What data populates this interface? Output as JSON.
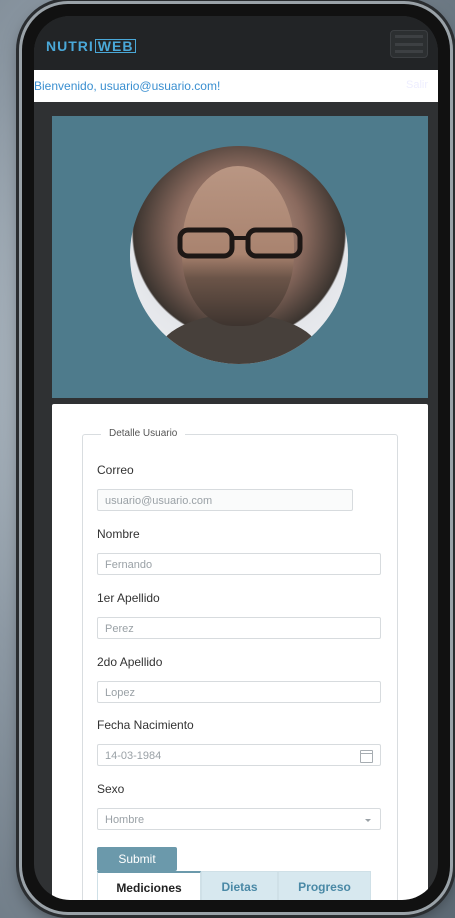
{
  "navbar": {
    "logo_part1": "NUTRI",
    "logo_part2": "WEB",
    "menu_icon": "hamburger-icon"
  },
  "welcome": {
    "text": "Bienvenido, usuario@usuario.com!",
    "right_link": "Salir"
  },
  "profile": {
    "avatar_icon": "user-photo"
  },
  "form": {
    "legend": "Detalle Usuario",
    "fields": {
      "correo": {
        "label": "Correo",
        "value": "usuario@usuario.com"
      },
      "nombre": {
        "label": "Nombre",
        "value": "Fernando"
      },
      "apellido1": {
        "label": "1er Apellido",
        "value": "Perez"
      },
      "apellido2": {
        "label": "2do Apellido",
        "value": "Lopez"
      },
      "fecha": {
        "label": "Fecha Nacimiento",
        "value": "14-03-1984",
        "icon": "calendar-icon"
      },
      "sexo": {
        "label": "Sexo",
        "value": "Hombre",
        "icon": "chevron-down-icon"
      }
    },
    "submit_label": "Submit"
  },
  "tabs": [
    {
      "label": "Mediciones",
      "active": true
    },
    {
      "label": "Dietas",
      "active": false
    },
    {
      "label": "Progreso",
      "active": false
    }
  ],
  "colors": {
    "header_bg": "#4e7b8c",
    "accent": "#6b99ab",
    "link": "#3a8fd0"
  }
}
